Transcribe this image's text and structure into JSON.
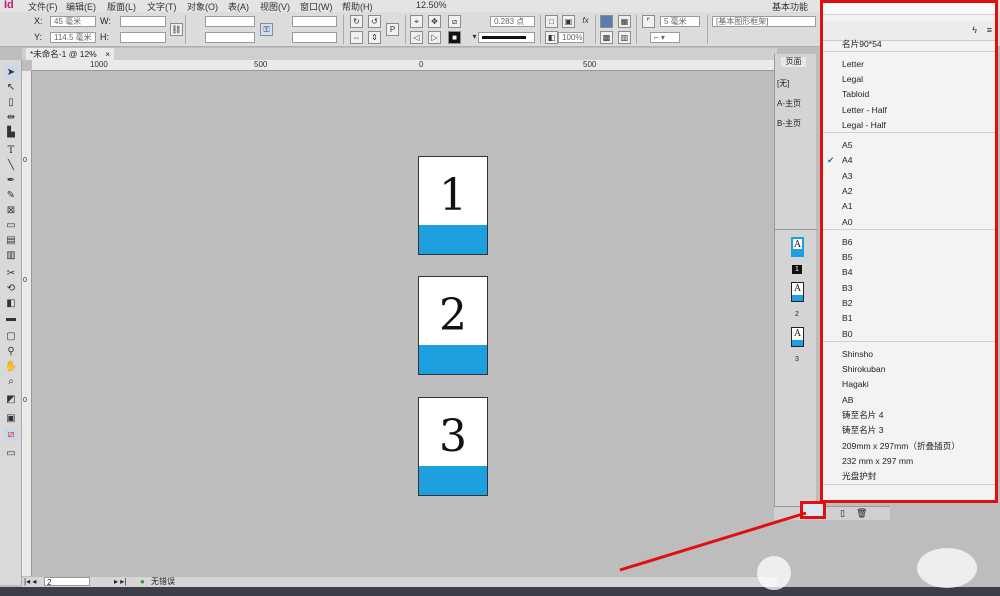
{
  "app": {
    "logo": "Id"
  },
  "menubar": {
    "items": [
      "文件(F)",
      "编辑(E)",
      "版面(L)",
      "文字(T)",
      "对象(O)",
      "表(A)",
      "视图(V)",
      "窗口(W)",
      "帮助(H)"
    ],
    "zoom": "12.50%",
    "workspace": "基本功能"
  },
  "control": {
    "x_label": "X:",
    "x_value": "45 毫米",
    "y_label": "Y:",
    "y_value": "114.5 毫米",
    "w_label": "W:",
    "w_value": "",
    "h_label": "H:",
    "h_value": "",
    "stroke_weight": "0.283 点",
    "opacity": "100%",
    "corner": "5 毫米",
    "style": "[基本图形框架]"
  },
  "tab": {
    "title": "*未命名-1 @ 12%",
    "close": "×"
  },
  "rulers": {
    "h": [
      "1000",
      "500",
      "0",
      "500"
    ],
    "v": [
      "0",
      "0",
      "0"
    ]
  },
  "pages": [
    {
      "number": "1"
    },
    {
      "number": "2"
    },
    {
      "number": "3"
    }
  ],
  "status": {
    "page": "2",
    "preflight": "无错误"
  },
  "panel": {
    "tab": "页面",
    "masters": [
      "[无]",
      "A-主页",
      "B-主页"
    ],
    "thumb_labels": [
      "1",
      "2",
      "3"
    ],
    "thumb_master": "A"
  },
  "menu": {
    "items": [
      {
        "label": "名片90*54"
      },
      {
        "label": "Letter"
      },
      {
        "label": "Legal"
      },
      {
        "label": "Tabloid"
      },
      {
        "label": "Letter - Half"
      },
      {
        "label": "Legal - Half"
      },
      {
        "label": "A5"
      },
      {
        "label": "A4",
        "checked": true
      },
      {
        "label": "A3"
      },
      {
        "label": "A2"
      },
      {
        "label": "A1"
      },
      {
        "label": "A0"
      },
      {
        "label": "B6"
      },
      {
        "label": "B5"
      },
      {
        "label": "B4"
      },
      {
        "label": "B3"
      },
      {
        "label": "B2"
      },
      {
        "label": "B1"
      },
      {
        "label": "B0"
      },
      {
        "label": "Shinsho"
      },
      {
        "label": "Shirokuban"
      },
      {
        "label": "Hagaki"
      },
      {
        "label": "AB"
      },
      {
        "label": "铸至名片 4"
      },
      {
        "label": "铸至名片 3"
      },
      {
        "label": "209mm x 297mm（折叠插页）"
      },
      {
        "label": "232 mm x 297 mm"
      },
      {
        "label": "光盘护封"
      }
    ],
    "check_glyph": "✔"
  },
  "colors": {
    "band": "#1d9fe0",
    "highlight": "#e01010"
  }
}
